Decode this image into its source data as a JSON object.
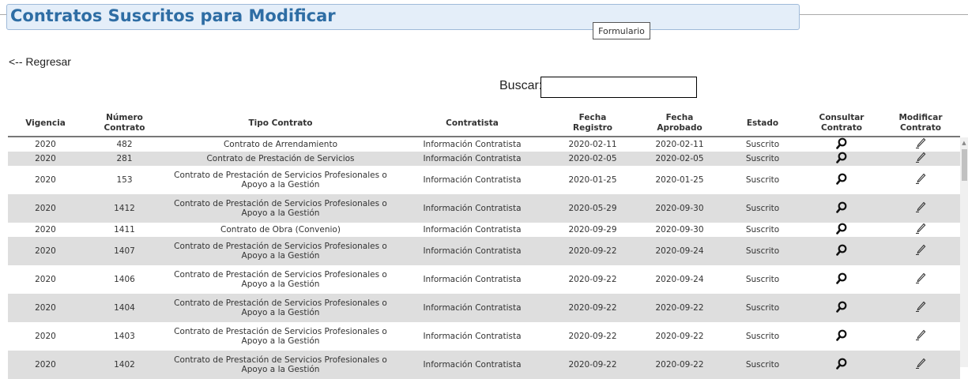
{
  "header": {
    "title": "Contratos Suscritos para Modificar",
    "form_tab": "Formulario"
  },
  "nav": {
    "back_label": "<-- Regresar"
  },
  "search": {
    "label": "Buscar:",
    "value": ""
  },
  "table": {
    "columns": [
      {
        "l1": "Vigencia",
        "l2": ""
      },
      {
        "l1": "Número",
        "l2": "Contrato"
      },
      {
        "l1": "Tipo Contrato",
        "l2": ""
      },
      {
        "l1": "Contratista",
        "l2": ""
      },
      {
        "l1": "Fecha",
        "l2": "Registro"
      },
      {
        "l1": "Fecha",
        "l2": "Aprobado"
      },
      {
        "l1": "Estado",
        "l2": ""
      },
      {
        "l1": "Consultar",
        "l2": "Contrato"
      },
      {
        "l1": "Modificar",
        "l2": "Contrato"
      }
    ],
    "rows": [
      {
        "vigencia": "2020",
        "numero": "482",
        "tipo_l1": "Contrato de Arrendamiento",
        "tipo_l2": "",
        "contratista": "Información Contratista",
        "registro": "2020-02-11",
        "aprobado": "2020-02-11",
        "estado": "Suscrito",
        "consultar_icon": "magnifier-icon",
        "modificar_icon": "pencil-icon"
      },
      {
        "vigencia": "2020",
        "numero": "281",
        "tipo_l1": "Contrato de Prestación de Servicios",
        "tipo_l2": "",
        "contratista": "Información Contratista",
        "registro": "2020-02-05",
        "aprobado": "2020-02-05",
        "estado": "Suscrito",
        "consultar_icon": "magnifier-icon",
        "modificar_icon": "pencil-icon"
      },
      {
        "vigencia": "2020",
        "numero": "153",
        "tipo_l1": "Contrato de Prestación de Servicios Profesionales o",
        "tipo_l2": "Apoyo a la Gestión",
        "contratista": "Información Contratista",
        "registro": "2020-01-25",
        "aprobado": "2020-01-25",
        "estado": "Suscrito",
        "consultar_icon": "magnifier-icon",
        "modificar_icon": "pencil-icon"
      },
      {
        "vigencia": "2020",
        "numero": "1412",
        "tipo_l1": "Contrato de Prestación de Servicios Profesionales o",
        "tipo_l2": "Apoyo a la Gestión",
        "contratista": "Información Contratista",
        "registro": "2020-05-29",
        "aprobado": "2020-09-30",
        "estado": "Suscrito",
        "consultar_icon": "magnifier-icon",
        "modificar_icon": "pencil-icon"
      },
      {
        "vigencia": "2020",
        "numero": "1411",
        "tipo_l1": "Contrato de Obra (Convenio)",
        "tipo_l2": "",
        "contratista": "Información Contratista",
        "registro": "2020-09-29",
        "aprobado": "2020-09-30",
        "estado": "Suscrito",
        "consultar_icon": "magnifier-icon",
        "modificar_icon": "pencil-icon"
      },
      {
        "vigencia": "2020",
        "numero": "1407",
        "tipo_l1": "Contrato de Prestación de Servicios Profesionales o",
        "tipo_l2": "Apoyo a la Gestión",
        "contratista": "Información Contratista",
        "registro": "2020-09-22",
        "aprobado": "2020-09-24",
        "estado": "Suscrito",
        "consultar_icon": "magnifier-icon",
        "modificar_icon": "pencil-icon"
      },
      {
        "vigencia": "2020",
        "numero": "1406",
        "tipo_l1": "Contrato de Prestación de Servicios Profesionales o",
        "tipo_l2": "Apoyo a la Gestión",
        "contratista": "Información Contratista",
        "registro": "2020-09-22",
        "aprobado": "2020-09-24",
        "estado": "Suscrito",
        "consultar_icon": "magnifier-icon",
        "modificar_icon": "pencil-icon"
      },
      {
        "vigencia": "2020",
        "numero": "1404",
        "tipo_l1": "Contrato de Prestación de Servicios Profesionales o",
        "tipo_l2": "Apoyo a la Gestión",
        "contratista": "Información Contratista",
        "registro": "2020-09-22",
        "aprobado": "2020-09-22",
        "estado": "Suscrito",
        "consultar_icon": "magnifier-icon",
        "modificar_icon": "pencil-icon"
      },
      {
        "vigencia": "2020",
        "numero": "1403",
        "tipo_l1": "Contrato de Prestación de Servicios Profesionales o",
        "tipo_l2": "Apoyo a la Gestión",
        "contratista": "Información Contratista",
        "registro": "2020-09-22",
        "aprobado": "2020-09-22",
        "estado": "Suscrito",
        "consultar_icon": "magnifier-icon",
        "modificar_icon": "pencil-icon"
      },
      {
        "vigencia": "2020",
        "numero": "1402",
        "tipo_l1": "Contrato de Prestación de Servicios Profesionales o",
        "tipo_l2": "Apoyo a la Gestión",
        "contratista": "Información Contratista",
        "registro": "2020-09-22",
        "aprobado": "2020-09-22",
        "estado": "Suscrito",
        "consultar_icon": "magnifier-icon",
        "modificar_icon": "pencil-icon"
      }
    ]
  },
  "colors": {
    "title": "#2e6da4",
    "header_bg": "#e4eef9",
    "row_alt": "#dedede"
  }
}
